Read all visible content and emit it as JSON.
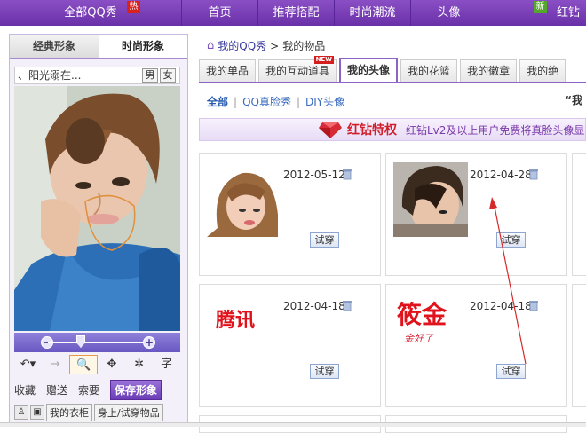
{
  "topnav": {
    "items": [
      "全部QQ秀",
      "首页",
      "推荐搭配",
      "时尚潮流",
      "头像",
      "红钻"
    ],
    "hot_badge": "热",
    "new_badge": "新"
  },
  "left": {
    "tabs": [
      "经典形象",
      "时尚形象"
    ],
    "user_name": "、阳光溺在...",
    "gender_male": "男",
    "gender_female": "女",
    "tool_char": "字",
    "actions": [
      "收藏",
      "赠送",
      "索要"
    ],
    "save_label": "保存形象",
    "bottom_tabs": [
      "我的衣柜",
      "身上/试穿物品"
    ]
  },
  "breadcrumb": {
    "root": "我的QQ秀",
    "sep": ">",
    "current": "我的物品"
  },
  "content_tabs": [
    "我的单品",
    "我的互动道具",
    "我的头像",
    "我的花篮",
    "我的徽章",
    "我的绝"
  ],
  "content_tab_new": "NEW",
  "subnav": {
    "items": [
      "全部",
      "QQ真脸秀",
      "DIY头像"
    ],
    "sep": "|",
    "quote": "“我"
  },
  "banner": {
    "title": "红钻特权",
    "desc": "红钻Lv2及以上用户免费将真脸头像显"
  },
  "cards": [
    {
      "date": "2012-05-12",
      "try": "试穿",
      "kind": "photo-girl"
    },
    {
      "date": "2012-04-28",
      "try": "试穿",
      "kind": "photo-boy"
    },
    {
      "date": "2012-04-18",
      "try": "试穿",
      "kind": "text-logo",
      "logo": "腾讯"
    },
    {
      "date": "2012-04-18",
      "try": "试穿",
      "kind": "text-logo2",
      "logo": "筱金",
      "sub": "金好了"
    }
  ],
  "colors": {
    "nav_purple": "#6a30a8",
    "accent_red": "#d01e2a",
    "link_blue": "#3a6bbf"
  }
}
